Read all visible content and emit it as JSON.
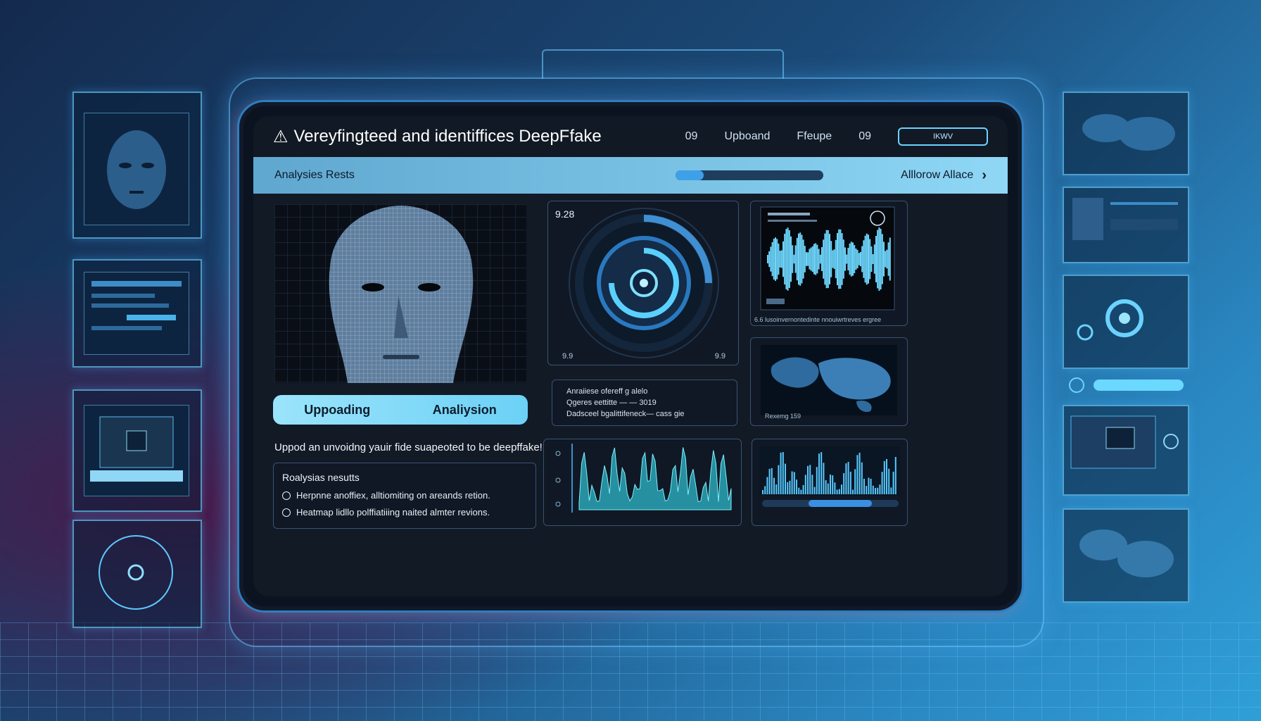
{
  "header": {
    "title": "Vereyfingteed and identiffices DeepFfake",
    "nav": [
      "09",
      "Upboand",
      "Ffeupe",
      "09"
    ],
    "nav_button": "IKWV"
  },
  "results_bar": {
    "title": "Analysies Rests",
    "progress": 0.19,
    "link": "Alllorow Allace"
  },
  "actions": {
    "upload_label": "Uppoading",
    "analysis_label": "Analiysion"
  },
  "upload_text": "Uppod an unvoidng yauir fide suapeoted to be deepffake!.",
  "analysis": {
    "heading": "Roalysias nesutts",
    "items": [
      "Herpnne anoffiex, alltiomiting on areands retion.",
      "Heatmap lidllo polffiatiiing naited almter revions."
    ]
  },
  "gauge": {
    "value": "9.28",
    "left_label": "9.9",
    "right_label": "9.9"
  },
  "info": {
    "line1": "Anraiiese ofereff g alelo",
    "line2": "Qgeres eettitte — — 3019",
    "line3": "Dadsceel bgalittifeneck— cass gie"
  },
  "wave_caption": "6.6 lusoinvernontedinte nnouiwrtreves ergree",
  "map_caption": "Rexemg 159",
  "colors": {
    "accent": "#6bd2ff",
    "panel_bg": "#0f1824",
    "results_bar": "#8fd7f5"
  }
}
